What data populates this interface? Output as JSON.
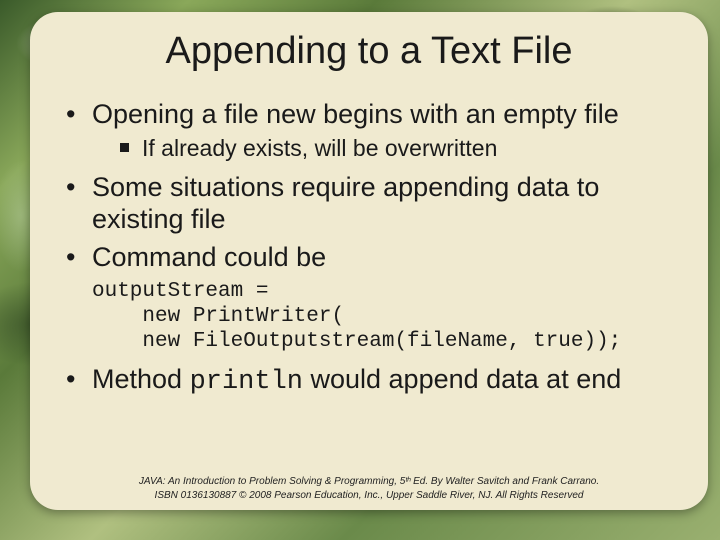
{
  "slide": {
    "title": "Appending to a Text File",
    "bullets": {
      "b1": "Opening a file new begins with an empty file",
      "b1_sub1": "If already exists, will be overwritten",
      "b2": "Some situations require appending data to existing file",
      "b3": "Command could be",
      "code": "outputStream =\n    new PrintWriter(\n    new FileOutputstream(fileName, true));",
      "b4_pre": "Method ",
      "b4_code": "println",
      "b4_post": " would append data at end"
    },
    "footer": {
      "line1": "JAVA: An Introduction to Problem Solving & Programming, 5ᵗʰ Ed. By Walter Savitch and Frank Carrano.",
      "line2": "ISBN 0136130887 © 2008 Pearson Education, Inc., Upper Saddle River, NJ. All Rights Reserved"
    }
  }
}
